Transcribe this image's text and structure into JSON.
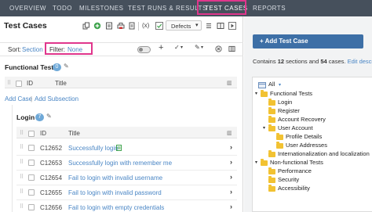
{
  "nav": {
    "items": [
      "OVERVIEW",
      "TODO",
      "MILESTONES",
      "TEST RUNS & RESULTS",
      "TEST CASES",
      "REPORTS"
    ],
    "active": "TEST CASES"
  },
  "header": {
    "title": "Test Cases",
    "defects_label": "Defects",
    "formula_label": "(x)"
  },
  "sortbar": {
    "sort_label": "Sort:",
    "sort_value": "Section",
    "filter_label": "Filter:",
    "filter_value": "None"
  },
  "functional": {
    "title": "Functional Tests",
    "count": "0",
    "col_id": "ID",
    "col_title": "Title",
    "add_case": "Add Case",
    "add_subsection": "Add Subsection",
    "separator": "|"
  },
  "login": {
    "title": "Login",
    "count": "7",
    "col_id": "ID",
    "col_title": "Title",
    "rows": [
      {
        "id": "C12652",
        "title": "Successfully login"
      },
      {
        "id": "C12653",
        "title": "Successfully login with remember me"
      },
      {
        "id": "C12654",
        "title": "Fail to login with invalid username"
      },
      {
        "id": "C12655",
        "title": "Fail to login with invalid password"
      },
      {
        "id": "C12656",
        "title": "Fail to login with empty credentials"
      }
    ]
  },
  "sidebar": {
    "add_button": "+ Add Test Case",
    "summary_prefix": "Contains",
    "sections_count": "12",
    "sections_word": "sections and",
    "cases_count": "54",
    "cases_word": "cases.",
    "edit_link": "Edit descr",
    "all_label": "All",
    "tree": [
      {
        "label": "Functional Tests",
        "level": 0,
        "toggle": "▾"
      },
      {
        "label": "Login",
        "level": 1,
        "toggle": ""
      },
      {
        "label": "Register",
        "level": 1,
        "toggle": ""
      },
      {
        "label": "Account Recovery",
        "level": 1,
        "toggle": ""
      },
      {
        "label": "User Account",
        "level": 1,
        "toggle": "▾"
      },
      {
        "label": "Profile Details",
        "level": 2,
        "toggle": ""
      },
      {
        "label": "User Addresses",
        "level": 2,
        "toggle": ""
      },
      {
        "label": "Internationalization and localization",
        "level": 1,
        "toggle": ""
      },
      {
        "label": "Non-functional Tests",
        "level": 0,
        "toggle": "▾"
      },
      {
        "label": "Performance",
        "level": 1,
        "toggle": ""
      },
      {
        "label": "Security",
        "level": 1,
        "toggle": ""
      },
      {
        "label": "Accessibility",
        "level": 1,
        "toggle": ""
      }
    ]
  },
  "colors": {
    "nav_bg": "#46505c",
    "highlight": "#e0368c",
    "link": "#4a86c5",
    "badge": "#6fa9d8",
    "primary_button": "#3d6fa6",
    "folder": "#f2c232"
  }
}
